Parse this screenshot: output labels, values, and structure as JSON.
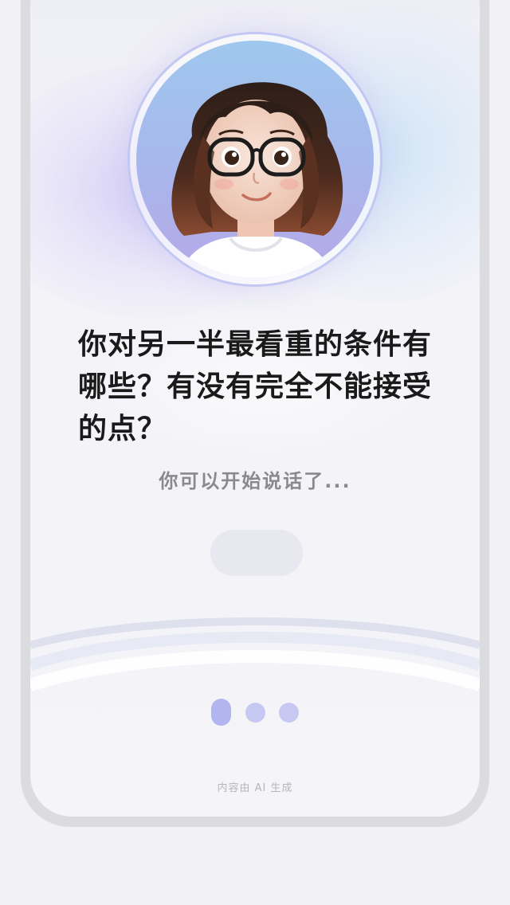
{
  "conversation": {
    "question": "你对另一半最看重的条件有哪些？有没有完全不能接受的点？",
    "hint": "你可以开始说话了...",
    "pagination": {
      "total": 3,
      "active": 1
    }
  },
  "footer": {
    "ai_note": "内容由 AI 生成"
  },
  "colors": {
    "accent": "#b2b6f0",
    "question_text": "#1a1a1a",
    "hint_text": "#8a8a8e"
  },
  "icons": {
    "avatar": "avatar-icon"
  }
}
